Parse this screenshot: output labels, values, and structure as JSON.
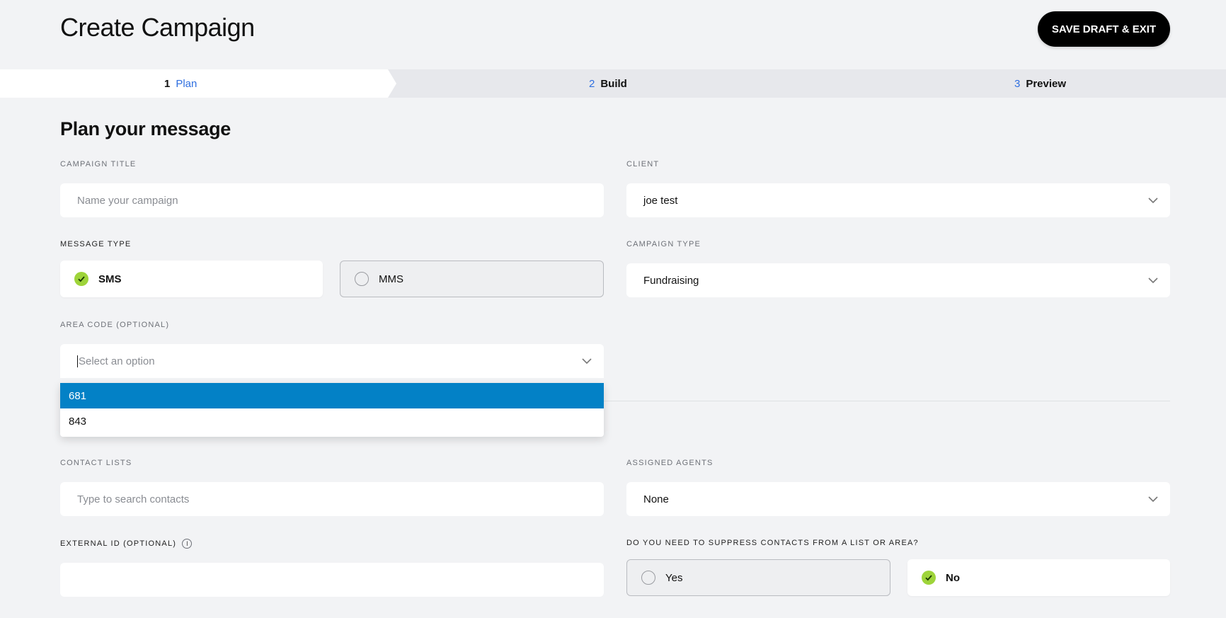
{
  "header": {
    "title": "Create Campaign",
    "save_label": "SAVE DRAFT & EXIT"
  },
  "steps": [
    {
      "num": "1",
      "label": "Plan",
      "state": "active"
    },
    {
      "num": "2",
      "label": "Build",
      "state": "upcoming"
    },
    {
      "num": "3",
      "label": "Preview",
      "state": "upcoming"
    }
  ],
  "section_title": "Plan your message",
  "campaign_title": {
    "label": "CAMPAIGN TITLE",
    "placeholder": "Name your campaign",
    "value": ""
  },
  "client": {
    "label": "CLIENT",
    "value": "joe test"
  },
  "message_type": {
    "label": "MESSAGE TYPE",
    "options": [
      {
        "label": "SMS",
        "selected": true
      },
      {
        "label": "MMS",
        "selected": false
      }
    ]
  },
  "campaign_type": {
    "label": "CAMPAIGN TYPE",
    "value": "Fundraising"
  },
  "area_code": {
    "label": "AREA CODE (OPTIONAL)",
    "placeholder": "Select an option",
    "options": [
      "681",
      "843"
    ],
    "highlighted": "681"
  },
  "contact_lists": {
    "label": "CONTACT LISTS",
    "placeholder": "Type to search contacts"
  },
  "assigned_agents": {
    "label": "ASSIGNED AGENTS",
    "value": "None"
  },
  "external_id": {
    "label": "EXTERNAL ID (OPTIONAL)",
    "info_glyph": "i",
    "value": ""
  },
  "suppress": {
    "label": "DO YOU NEED TO SUPPRESS CONTACTS FROM A LIST OR AREA?",
    "options": [
      {
        "label": "Yes",
        "selected": false
      },
      {
        "label": "No",
        "selected": true
      }
    ]
  },
  "colors": {
    "accent_blue": "#2f6fe0",
    "highlight_blue": "#0381c6",
    "check_green": "#9ed43a",
    "button_black": "#000000"
  },
  "icons": [
    "chevron-down-icon",
    "check-icon",
    "info-icon"
  ]
}
